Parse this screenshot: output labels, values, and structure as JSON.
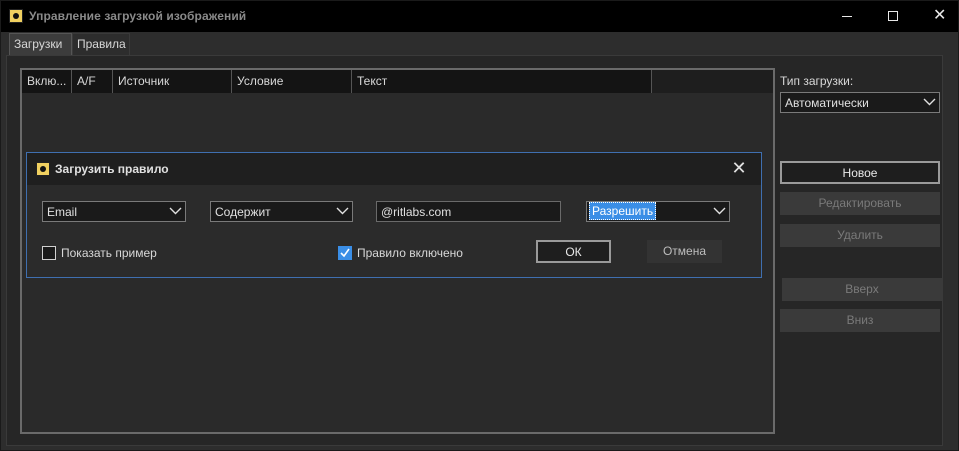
{
  "window": {
    "title": "Управление загрузкой изображений",
    "controls": {
      "minimize": "minimize-icon",
      "maximize": "maximize-icon",
      "close": "close-icon"
    }
  },
  "tabs": [
    {
      "label": "Загрузки"
    },
    {
      "label": "Правила"
    }
  ],
  "rules_list": {
    "columns": [
      "Вклю...",
      "A/F",
      "Источник",
      "Условие",
      "Текст"
    ]
  },
  "right_panel": {
    "download_type_label": "Тип загрузки:",
    "download_type_value": "Автоматически",
    "buttons": {
      "new": "Новое",
      "edit": "Редактировать",
      "delete": "Удалить",
      "up": "Вверх",
      "down": "Вниз"
    }
  },
  "dialog": {
    "title": "Загрузить правило",
    "source_value": "Email",
    "condition_value": "Содержит",
    "text_value": "@ritlabs.com",
    "action_value": "Разрешить",
    "show_example_label": "Показать пример",
    "show_example_checked": false,
    "rule_enabled_label": "Правило включено",
    "rule_enabled_checked": true,
    "ok_label": "ОК",
    "cancel_label": "Отмена"
  },
  "colors": {
    "accent": "#3a8ee6",
    "dialog_border": "#3f6fb0",
    "background": "#2d2d2d"
  }
}
